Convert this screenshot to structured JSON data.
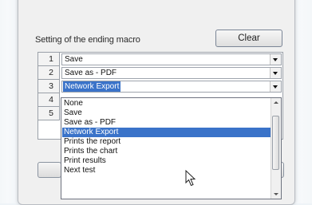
{
  "section": {
    "title": "Setting of the ending macro",
    "clear_label": "Clear"
  },
  "rows": [
    {
      "num": "1",
      "value": "Save"
    },
    {
      "num": "2",
      "value": "Save as - PDF"
    },
    {
      "num": "3",
      "value": "Network Export",
      "selected": true
    },
    {
      "num": "4",
      "value": ""
    },
    {
      "num": "5",
      "value": ""
    }
  ],
  "dropdown": {
    "options": [
      "None",
      "Save",
      "Save as - PDF",
      "Network Export",
      "Prints the report",
      "Prints the chart",
      "Print results",
      "Next test"
    ],
    "selected": "Network Export"
  },
  "colors": {
    "selection": "#3a73c9"
  }
}
